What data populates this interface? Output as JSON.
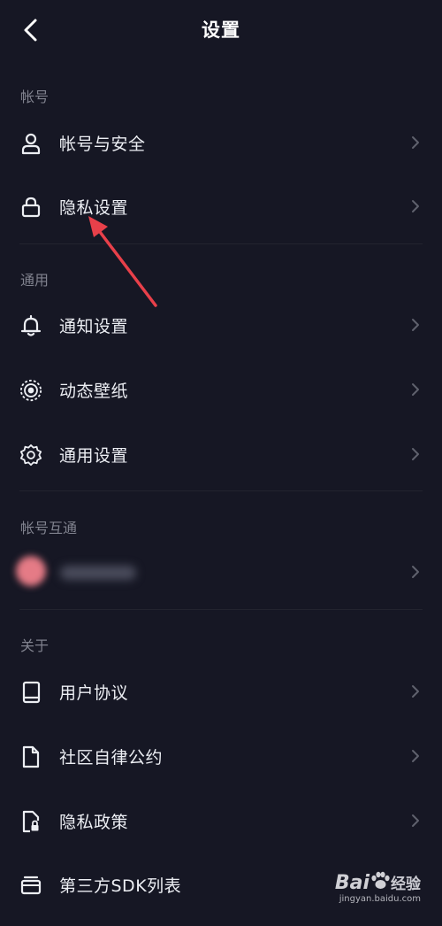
{
  "header": {
    "title": "设置",
    "back_icon": "chevron-left-icon"
  },
  "sections": {
    "account": {
      "title": "帐号",
      "items": [
        {
          "label": "帐号与安全",
          "icon": "user-icon"
        },
        {
          "label": "隐私设置",
          "icon": "lock-icon"
        }
      ]
    },
    "general": {
      "title": "通用",
      "items": [
        {
          "label": "通知设置",
          "icon": "bell-icon"
        },
        {
          "label": "动态壁纸",
          "icon": "live-wallpaper-icon"
        },
        {
          "label": "通用设置",
          "icon": "gear-icon"
        }
      ]
    },
    "linked": {
      "title": "帐号互通"
    },
    "about": {
      "title": "关于",
      "items": [
        {
          "label": "用户协议",
          "icon": "book-icon"
        },
        {
          "label": "社区自律公约",
          "icon": "document-icon"
        },
        {
          "label": "隐私政策",
          "icon": "privacy-document-icon"
        },
        {
          "label": "第三方SDK列表",
          "icon": "card-list-icon"
        }
      ]
    }
  },
  "watermark": {
    "brand": "Bai",
    "brand_suffix": "经验",
    "url": "jingyan.baidu.com"
  },
  "colors": {
    "background": "#161724",
    "section_header": "#80828e",
    "text": "#eceef3",
    "annotation_arrow": "#e8404a"
  }
}
